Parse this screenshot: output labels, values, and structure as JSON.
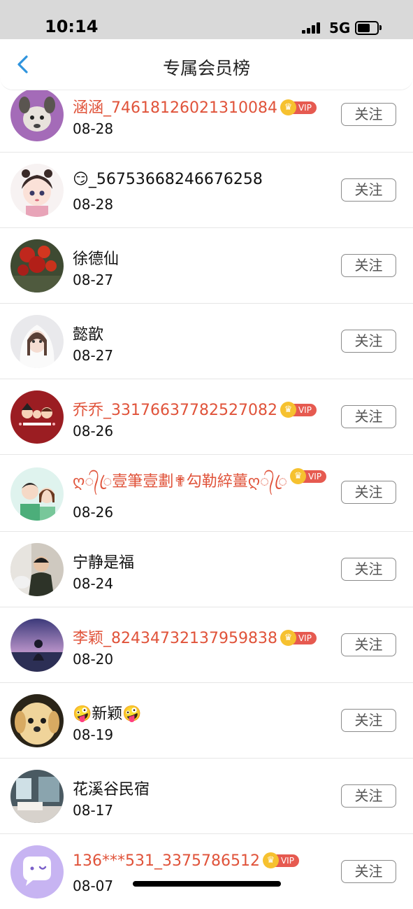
{
  "status_bar": {
    "time": "10:14",
    "network": "5G"
  },
  "header": {
    "title": "专属会员榜",
    "back_icon": "chevron-left-icon",
    "accent": "#2f94de"
  },
  "follow_label": "关注",
  "vip_label": "VIP",
  "members": [
    {
      "name": "涵涵_74618126021310084",
      "date": "08-28",
      "vip": true,
      "avatar": "plush-toy-avatar"
    },
    {
      "name": "😏_56753668246676258",
      "date": "08-28",
      "vip": false,
      "avatar": "cartoon-girl-avatar"
    },
    {
      "name": "徐德仙",
      "date": "08-27",
      "vip": false,
      "avatar": "red-flowers-avatar"
    },
    {
      "name": "懿歆",
      "date": "08-27",
      "vip": false,
      "avatar": "bride-illustration-avatar"
    },
    {
      "name": "乔乔_33176637782527082",
      "date": "08-26",
      "vip": true,
      "avatar": "family-cartoon-avatar"
    },
    {
      "name": "ღ᭄ꦿ壹筆壹劃✟勾勒綷薑ღ᭄ꦿ",
      "date": "08-26",
      "vip": true,
      "avatar": "couple-cartoon-avatar"
    },
    {
      "name": "宁静是福",
      "date": "08-24",
      "vip": false,
      "avatar": "child-photo-avatar"
    },
    {
      "name": "李颖_82434732137959838",
      "date": "08-20",
      "vip": true,
      "avatar": "sunset-girl-avatar"
    },
    {
      "name": "🤪新颖🤪",
      "date": "08-19",
      "vip": false,
      "avatar": "puppy-avatar"
    },
    {
      "name": "花溪谷民宿",
      "date": "08-17",
      "vip": false,
      "avatar": "room-interior-avatar"
    },
    {
      "name": "136***531_3375786512",
      "date": "08-07",
      "vip": true,
      "avatar": "default-chat-avatar"
    }
  ],
  "colors": {
    "vip_name": "#e0533a",
    "vip_badge": "#e65a50",
    "crown": "#f6c12f",
    "status_bar": "#d9d9d9"
  }
}
